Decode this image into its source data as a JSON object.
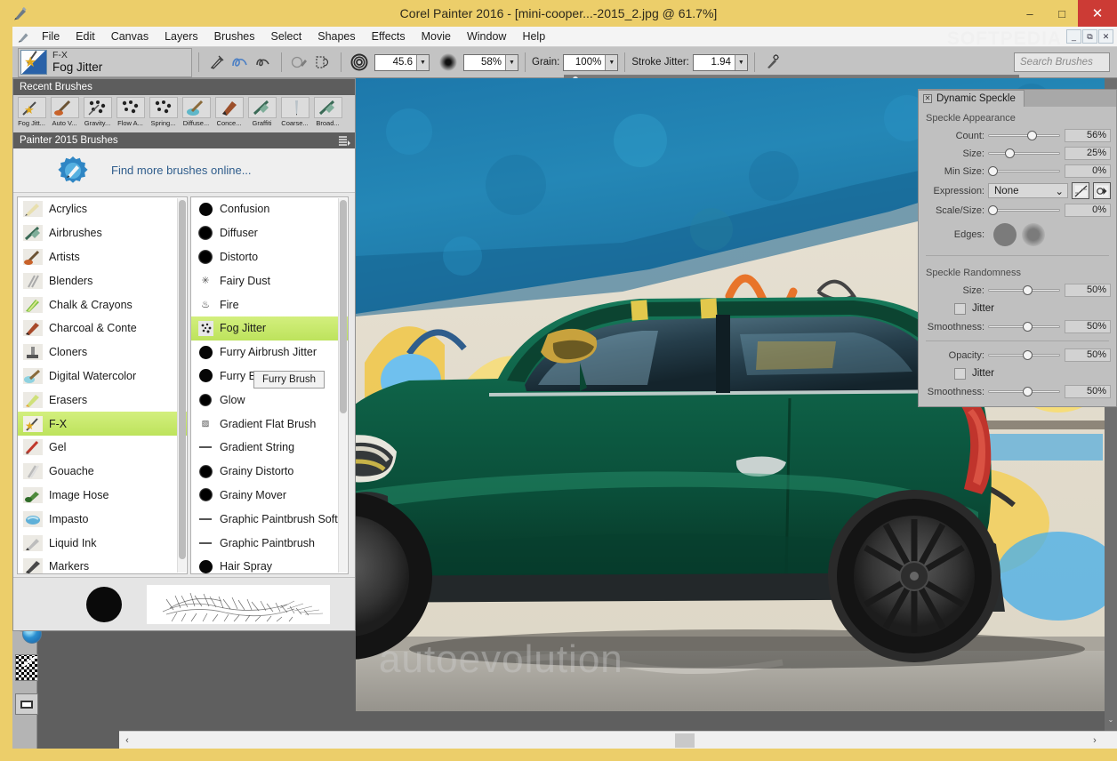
{
  "window": {
    "title": "Corel Painter 2016 - [mini-cooper...-2015_2.jpg @ 61.7%]",
    "app_icon": "painter-brush-icon",
    "minimize": "–",
    "maximize": "□",
    "close": "✕",
    "watermark": "SOFTPEDIA"
  },
  "doc_window_controls": {
    "minimize": "_",
    "restore": "⧉",
    "close": "✕"
  },
  "menu": {
    "icon": "painter-brush-icon",
    "items": [
      "File",
      "Edit",
      "Canvas",
      "Layers",
      "Brushes",
      "Select",
      "Shapes",
      "Effects",
      "Movie",
      "Window",
      "Help"
    ]
  },
  "propbar": {
    "brush_category": "F-X",
    "brush_variant": "Fog Jitter",
    "icons": [
      "brush-tool-icon",
      "freehand-stroke-icon",
      "straight-line-stroke-icon",
      "clone-color-icon",
      "dab-preview-icon"
    ],
    "size_icon": "concentric-size-icon",
    "size_value": "45.6",
    "opacity_icon": "soft-dab-opacity-icon",
    "opacity_value": "58%",
    "grain_label": "Grain:",
    "grain_value": "100%",
    "stroke_jitter_label": "Stroke Jitter:",
    "stroke_jitter_value": "1.94",
    "brush_controls_icon": "brush-controls-icon",
    "search_placeholder": "Search Brushes"
  },
  "brush_panel": {
    "recent_header": "Recent Brushes",
    "recent_brushes": [
      {
        "label": "Fog Jitt...",
        "icon": "fx-star-brush-icon"
      },
      {
        "label": "Auto V...",
        "icon": "artists-brush-icon"
      },
      {
        "label": "Gravity...",
        "icon": "particle-dots-icon"
      },
      {
        "label": "Flow A...",
        "icon": "particle-dots-icon"
      },
      {
        "label": "Spring...",
        "icon": "particle-dots-icon"
      },
      {
        "label": "Diffuse...",
        "icon": "watercolor-brush-icon"
      },
      {
        "label": "Conce...",
        "icon": "charcoal-brush-icon"
      },
      {
        "label": "Graffiti",
        "icon": "airbrush-icon"
      },
      {
        "label": "Coarse...",
        "icon": "pen-nib-icon"
      },
      {
        "label": "Broad...",
        "icon": "airbrush-icon"
      }
    ],
    "library_header": "Painter 2015 Brushes",
    "library_menu_icon": "panel-menu-icon",
    "find_more": "Find more brushes online...",
    "find_more_icon": "brush-badge-icon",
    "categories": [
      {
        "label": "Acrylics",
        "icon": "acrylics-icon",
        "selected": false
      },
      {
        "label": "Airbrushes",
        "icon": "airbrushes-icon",
        "selected": false
      },
      {
        "label": "Artists",
        "icon": "artists-icon",
        "selected": false
      },
      {
        "label": "Blenders",
        "icon": "blenders-icon",
        "selected": false
      },
      {
        "label": "Chalk & Crayons",
        "icon": "chalk-crayons-icon",
        "selected": false
      },
      {
        "label": "Charcoal & Conte",
        "icon": "charcoal-conte-icon",
        "selected": false
      },
      {
        "label": "Cloners",
        "icon": "cloners-icon",
        "selected": false
      },
      {
        "label": "Digital Watercolor",
        "icon": "digital-watercolor-icon",
        "selected": false
      },
      {
        "label": "Erasers",
        "icon": "erasers-icon",
        "selected": false
      },
      {
        "label": "F-X",
        "icon": "fx-icon",
        "selected": true
      },
      {
        "label": "Gel",
        "icon": "gel-icon",
        "selected": false
      },
      {
        "label": "Gouache",
        "icon": "gouache-icon",
        "selected": false
      },
      {
        "label": "Image Hose",
        "icon": "image-hose-icon",
        "selected": false
      },
      {
        "label": "Impasto",
        "icon": "impasto-icon",
        "selected": false
      },
      {
        "label": "Liquid Ink",
        "icon": "liquid-ink-icon",
        "selected": false
      },
      {
        "label": "Markers",
        "icon": "markers-icon",
        "selected": false
      }
    ],
    "variants": [
      {
        "label": "Confusion",
        "icon": "hard-dab-icon",
        "selected": false
      },
      {
        "label": "Diffuser",
        "icon": "soft-dab-icon",
        "selected": false
      },
      {
        "label": "Distorto",
        "icon": "soft-dab-icon",
        "selected": false
      },
      {
        "label": "Fairy Dust",
        "icon": "sparkle-dab-icon",
        "selected": false
      },
      {
        "label": "Fire",
        "icon": "flame-dab-icon",
        "selected": false
      },
      {
        "label": "Fog Jitter",
        "icon": "speckle-dab-icon",
        "selected": true
      },
      {
        "label": "Furry Airbrush Jitter",
        "icon": "hard-dab-icon",
        "selected": false
      },
      {
        "label": "Furry Brush",
        "icon": "hard-dab-icon",
        "selected": false
      },
      {
        "label": "Glow",
        "icon": "soft-dab-icon",
        "selected": false
      },
      {
        "label": "Gradient Flat Brush",
        "icon": "flat-dab-icon",
        "selected": false
      },
      {
        "label": "Gradient String",
        "icon": "line-dab-icon",
        "selected": false
      },
      {
        "label": "Grainy Distorto",
        "icon": "soft-dab-icon",
        "selected": false
      },
      {
        "label": "Grainy Mover",
        "icon": "soft-dab-icon",
        "selected": false
      },
      {
        "label": "Graphic Paintbrush Soft",
        "icon": "line-dab-icon",
        "selected": false
      },
      {
        "label": "Graphic Paintbrush",
        "icon": "line-dab-icon",
        "selected": false
      },
      {
        "label": "Hair Spray",
        "icon": "hard-dab-icon",
        "selected": false
      }
    ],
    "tooltip": "Furry Brush",
    "preview_dab_icon": "black-round-dab-preview",
    "preview_stroke_icon": "furry-stroke-preview"
  },
  "speckle_panel": {
    "tab_title": "Dynamic Speckle",
    "tab_close_icon": "close-icon",
    "appearance_title": "Speckle Appearance",
    "appearance": [
      {
        "label": "Count:",
        "value": "56%",
        "pos": 56
      },
      {
        "label": "Size:",
        "value": "25%",
        "pos": 25
      },
      {
        "label": "Min Size:",
        "value": "0%",
        "pos": 0
      }
    ],
    "expression_label": "Expression:",
    "expression_value": "None",
    "expression_caret": "⌄",
    "expression_btn_curve": "expression-curve-icon",
    "expression_btn_direction": "expression-direction-icon",
    "scale_size": {
      "label": "Scale/Size:",
      "value": "0%",
      "pos": 0
    },
    "edges_label": "Edges:",
    "edges_hard_icon": "hard-edge-dab-icon",
    "edges_soft_icon": "soft-edge-dab-icon",
    "randomness_title": "Speckle Randomness",
    "randomness": [
      {
        "label": "Size:",
        "value": "50%",
        "pos": 50
      },
      {
        "label": "Jitter",
        "type": "checkbox",
        "checked": false
      },
      {
        "label": "Smoothness:",
        "value": "50%",
        "pos": 50
      }
    ],
    "opacity_group": [
      {
        "label": "Opacity:",
        "value": "50%",
        "pos": 50
      },
      {
        "label": "Jitter",
        "type": "checkbox",
        "checked": false
      },
      {
        "label": "Smoothness:",
        "value": "50%",
        "pos": 50
      }
    ]
  },
  "toolbox": {
    "tools": [
      "brush-tool-icon",
      "dropper-tool-icon",
      "paint-bucket-icon",
      "eraser-tool-icon",
      "lasso-tool-icon",
      "magic-wand-icon",
      "rectangular-select-icon",
      "crop-tool-icon",
      "transform-tool-icon",
      "shape-select-icon",
      "pen-tool-icon",
      "text-tool-icon",
      "rectangle-shape-icon",
      "oval-shape-icon",
      "grabber-hand-icon",
      "magnifier-icon",
      "mirror-tool-icon",
      "perspective-grid-icon",
      "divine-proportion-icon",
      "cloner-tool-icon"
    ],
    "color_swatches_icon": "color-picker-swatches",
    "paper_swatch_icon": "paper-texture-swatch",
    "pattern_swatch_icon": "pattern-media-swatch"
  },
  "canvas": {
    "image_description": "green-mini-cooper-parked-in-front-of-graffiti-wall",
    "watermark": "autoevolution",
    "zoom": "61.7%"
  },
  "scrollbars": {
    "doc_h_left_arrow": "‹",
    "doc_h_right_arrow": "›",
    "doc_v_down_arrow": "⌄"
  },
  "colors": {
    "window_frame": "#ecce6a",
    "selection_green": "#bde35c",
    "panel_gray": "#c0c0c0",
    "close_red": "#cc3b35",
    "link_blue": "#2f5d8c",
    "car_green": "#0d5c43"
  }
}
